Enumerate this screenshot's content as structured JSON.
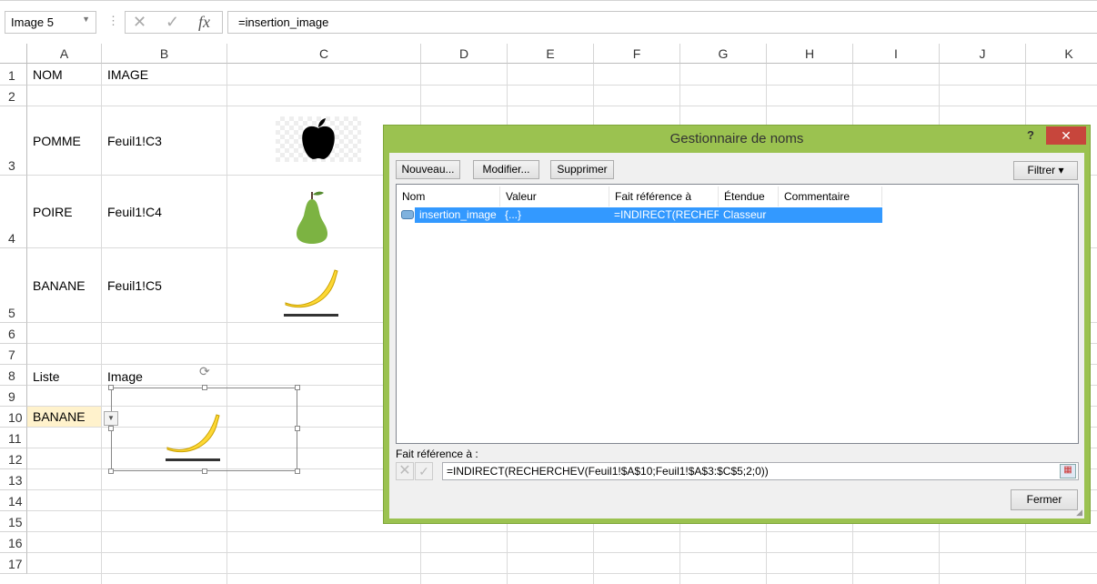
{
  "name_box": {
    "value": "Image 5"
  },
  "formula_bar": {
    "cancel_icon": "✕",
    "enter_icon": "✓",
    "fx_label": "fx",
    "value": "=insertion_image"
  },
  "columns": [
    "A",
    "B",
    "C",
    "D",
    "E",
    "F",
    "G",
    "H",
    "I",
    "J",
    "K"
  ],
  "rows": [
    "1",
    "2",
    "3",
    "4",
    "5",
    "6",
    "7",
    "8",
    "9",
    "10",
    "11",
    "12",
    "13",
    "14",
    "15",
    "16",
    "17"
  ],
  "cells": {
    "A1": "NOM",
    "B1": "IMAGE",
    "A3": "POMME",
    "B3": "Feuil1!C3",
    "A4": "POIRE",
    "B4": "Feuil1!C4",
    "A5": "BANANE",
    "B5": "Feuil1!C5",
    "A8": "Liste",
    "B8": "Image",
    "A10": "BANANE"
  },
  "dialog": {
    "title": "Gestionnaire de noms",
    "help": "?",
    "close": "✕",
    "buttons": {
      "new": "Nouveau...",
      "edit": "Modifier...",
      "delete": "Supprimer",
      "filter": "Filtrer ▾",
      "close": "Fermer"
    },
    "list_headers": [
      "Nom",
      "Valeur",
      "Fait référence à",
      "Étendue",
      "Commentaire"
    ],
    "list_rows": [
      {
        "name": "insertion_image",
        "value": "{...}",
        "refers_to": "=INDIRECT(RECHER...",
        "scope": "Classeur",
        "comment": ""
      }
    ],
    "refers_label": "Fait référence à :",
    "refers_value": "=INDIRECT(RECHERCHEV(Feuil1!$A$10;Feuil1!$A$3:$C$5;2;0))"
  }
}
